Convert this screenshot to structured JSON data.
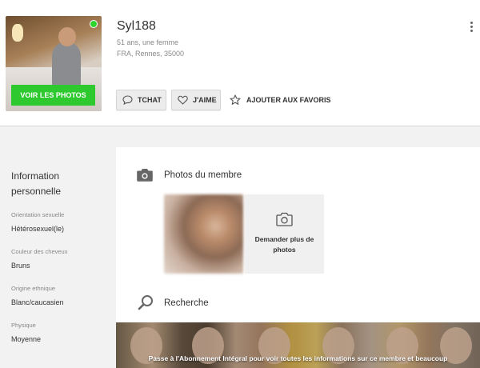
{
  "profile": {
    "username": "Syl188",
    "age_gender": "51 ans, une femme",
    "location": "FRA, Rennes, 35000",
    "online": true,
    "photos_button": "VOIR LES PHOTOS"
  },
  "actions": {
    "chat": "TCHAT",
    "like": "J'AIME",
    "favorite": "AJOUTER AUX FAVORIS"
  },
  "sidebar": {
    "title": "Information personnelle",
    "fields": [
      {
        "label": "Orientation sexuelle",
        "value": "Hétérosexuel(le)"
      },
      {
        "label": "Couleur des cheveux",
        "value": "Bruns"
      },
      {
        "label": "Origine ethnique",
        "value": "Blanc/caucasien"
      },
      {
        "label": "Physique",
        "value": "Moyenne"
      }
    ]
  },
  "main": {
    "photos_title": "Photos du membre",
    "request_more": "Demander plus de photos",
    "search_title": "Recherche",
    "banner_text": "Passe à l'Abonnement Intégral pour voir toutes les informations sur ce membre et beaucoup"
  },
  "colors": {
    "accent_green": "#2ec92e",
    "online_dot": "#2ed52e"
  }
}
